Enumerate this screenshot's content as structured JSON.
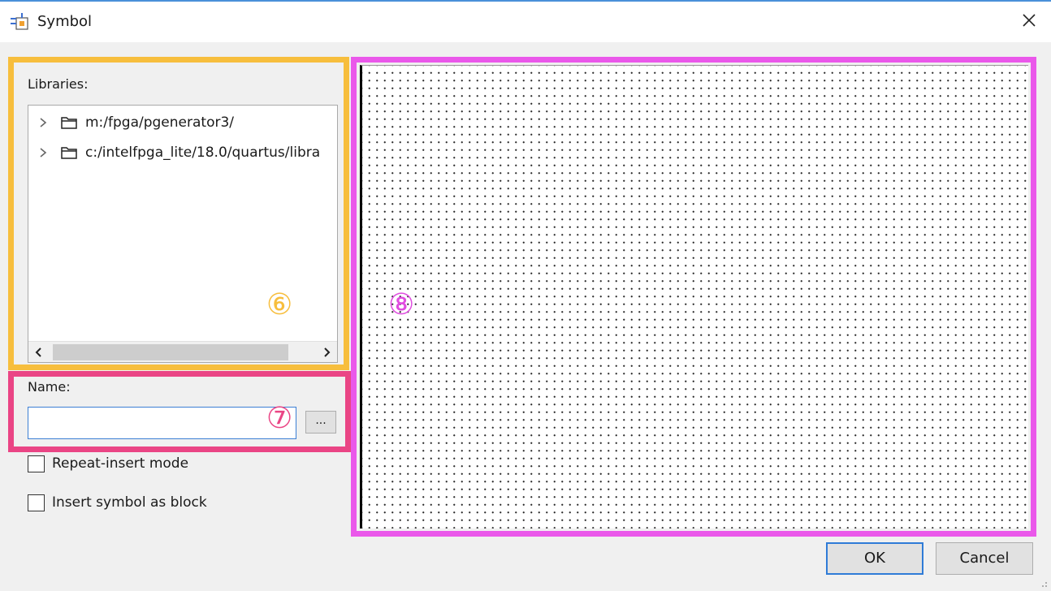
{
  "window": {
    "title": "Symbol",
    "accent_color": "#4a90d9",
    "icons": {
      "app": "symbol-app-icon",
      "close": "close-icon"
    }
  },
  "libraries": {
    "label": "Libraries:",
    "items": [
      {
        "path": "m:/fpga/pgenerator3/",
        "icon": "folder-icon",
        "expander": "chevron-right-icon"
      },
      {
        "path": "c:/intelfpga_lite/18.0/quartus/libra",
        "icon": "folder-icon",
        "expander": "chevron-right-icon"
      }
    ]
  },
  "name_field": {
    "label": "Name:",
    "value": "",
    "browse_label": "..."
  },
  "options": {
    "repeat_insert": {
      "label": "Repeat-insert mode",
      "checked": false
    },
    "insert_as_block": {
      "label": "Insert symbol as block",
      "checked": false
    }
  },
  "annotations": {
    "libraries_marker": "⑥",
    "name_marker": "⑦",
    "preview_marker": "⑧",
    "colors": {
      "libraries": "#f7be3d",
      "name": "#ea4585",
      "preview": "#ea58ea"
    }
  },
  "buttons": {
    "ok": "OK",
    "cancel": "Cancel"
  }
}
